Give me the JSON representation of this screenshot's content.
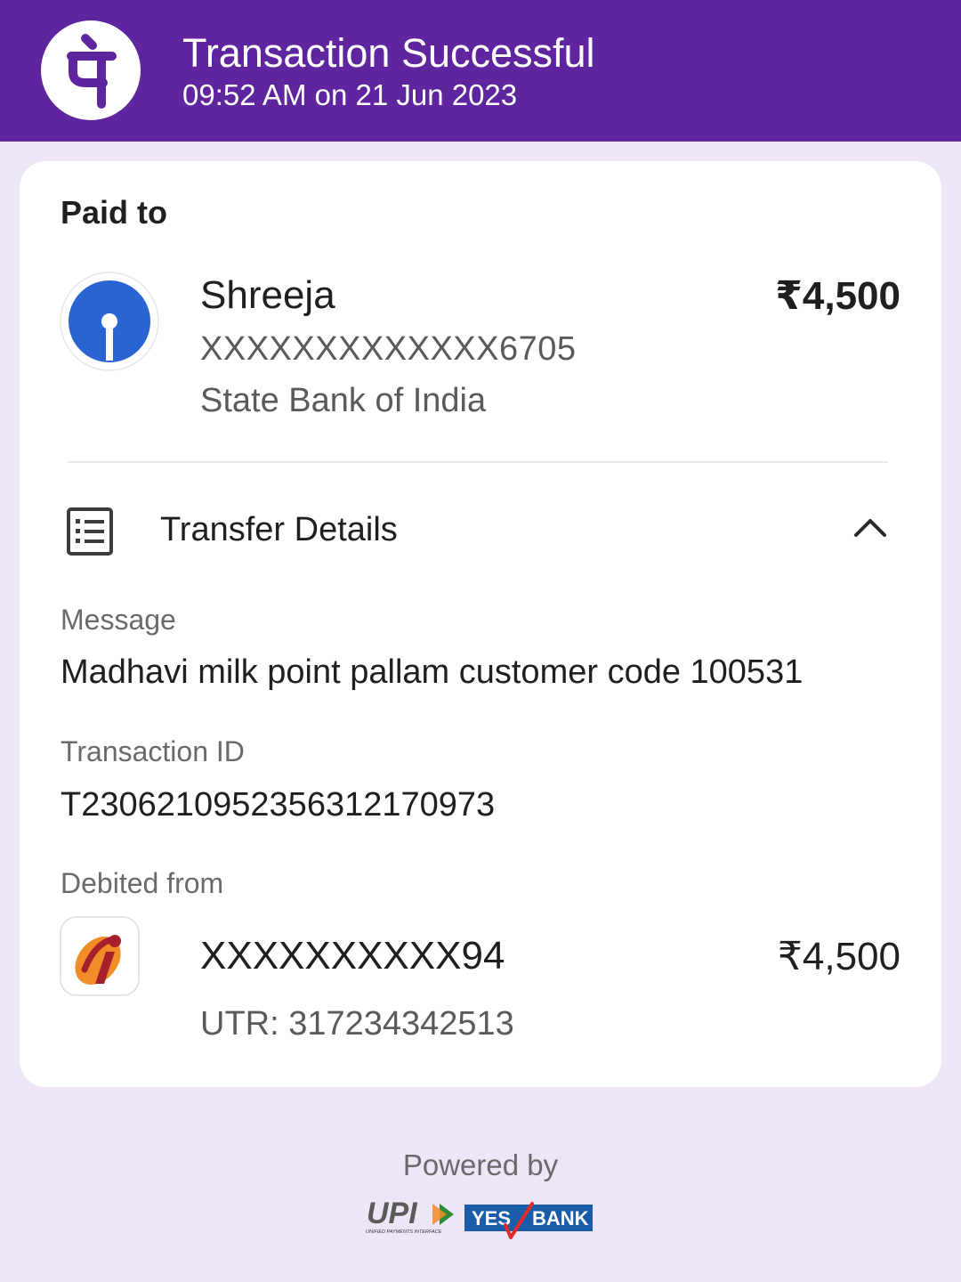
{
  "header": {
    "title": "Transaction Successful",
    "subtitle": "09:52 AM on 21 Jun 2023",
    "logo_icon": "phonepe-logo-icon",
    "bg_color": "#5f259f"
  },
  "paid_to": {
    "label": "Paid to",
    "name": "Shreeja",
    "account": "XXXXXXXXXXXXX6705",
    "bank": "State Bank of India",
    "bank_icon": "sbi-logo-icon",
    "amount": "₹4,500"
  },
  "transfer_details": {
    "label": "Transfer Details",
    "icon": "receipt-list-icon",
    "toggle_icon": "chevron-up-icon",
    "expanded": true,
    "message_label": "Message",
    "message": "Madhavi milk point pallam customer code 100531",
    "transaction_id_label": "Transaction ID",
    "transaction_id": "T2306210952356312170973",
    "debited_from_label": "Debited from",
    "debited_account": "XXXXXXXXXX94",
    "debited_amount": "₹4,500",
    "utr": "UTR: 317234342513",
    "debit_bank_icon": "icici-logo-icon"
  },
  "footer": {
    "powered_by": "Powered by",
    "upi_logo": "UPI",
    "upi_tagline": "UNIFIED PAYMENTS INTERFACE",
    "yes_bank_logo_yes": "YES",
    "yes_bank_logo_bank": "BANK"
  }
}
